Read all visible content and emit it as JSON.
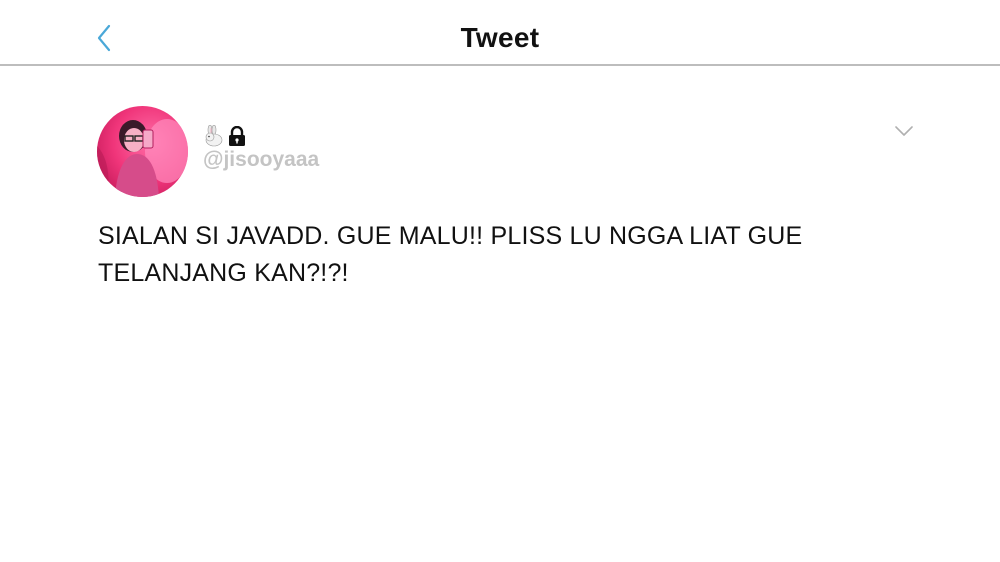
{
  "header": {
    "title": "Tweet",
    "back_icon": "chevron-left-icon",
    "accent_color": "#4aa8d8"
  },
  "tweet": {
    "display_name_icons": [
      "rabbit-emoji",
      "lock-icon"
    ],
    "handle": "@jisooyaaa",
    "menu_icon": "chevron-down-icon",
    "text": "SIALAN SI JAVADD. GUE MALU!! PLISS LU NGGA LIAT GUE TELANJANG KAN?!?!"
  },
  "colors": {
    "handle": "#c4c4c4",
    "divider": "#bdbdbd",
    "avatar_accent": "#f0357a"
  }
}
